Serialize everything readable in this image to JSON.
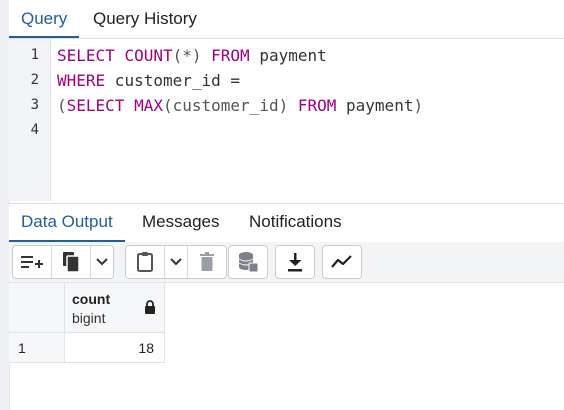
{
  "query_tabs": [
    {
      "label": "Query",
      "active": true
    },
    {
      "label": "Query History",
      "active": false
    }
  ],
  "editor": {
    "line_numbers": [
      "1",
      "2",
      "3",
      "4"
    ],
    "lines": [
      [
        "SELECT",
        " ",
        "COUNT",
        "(*)",
        " ",
        "FROM",
        " payment"
      ],
      [
        "WHERE",
        " customer_id ="
      ],
      [
        "(",
        "SELECT",
        " ",
        "MAX",
        "(customer_id)",
        " ",
        "FROM",
        " payment",
        ")"
      ],
      []
    ]
  },
  "result_tabs": [
    {
      "label": "Data Output",
      "active": true
    },
    {
      "label": "Messages",
      "active": false
    },
    {
      "label": "Notifications",
      "active": false
    }
  ],
  "toolbar": {
    "icons": [
      "add-row-icon",
      "copy-icon",
      "copy-dropdown-icon",
      "paste-icon",
      "paste-dropdown-icon",
      "delete-icon",
      "save-data-icon",
      "download-icon",
      "graph-icon"
    ]
  },
  "grid": {
    "columns": [
      {
        "name": "count",
        "type": "bigint"
      }
    ],
    "rows": [
      {
        "num": "1",
        "values": [
          "18"
        ]
      }
    ]
  },
  "colors": {
    "accent": "#1f5f9b",
    "keyword": "#a2007e"
  }
}
